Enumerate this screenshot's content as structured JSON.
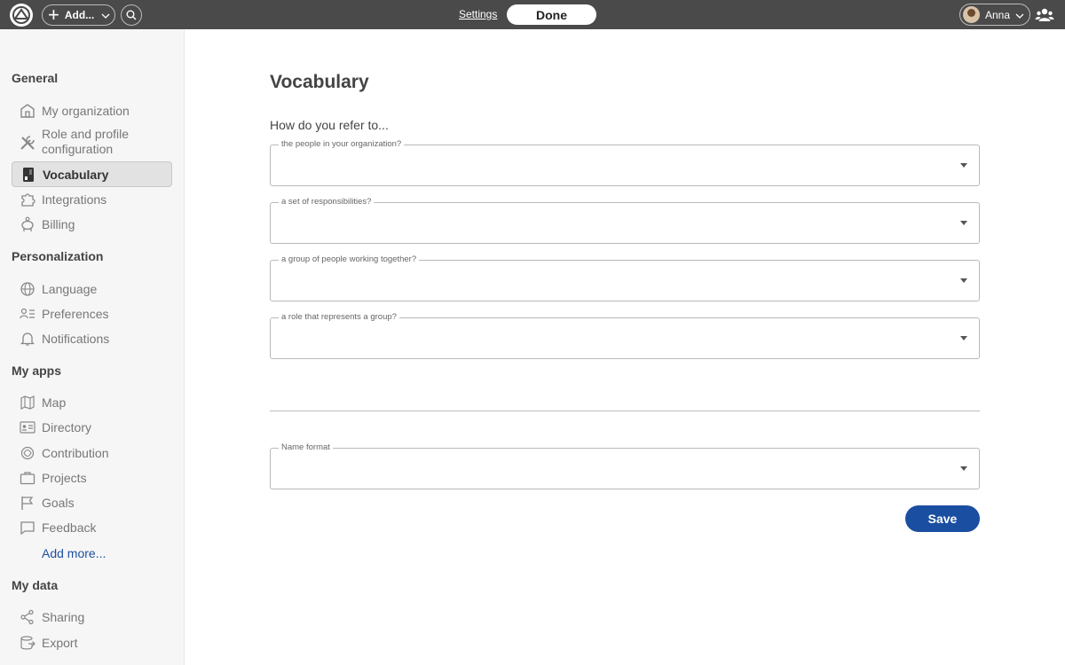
{
  "topbar": {
    "add_label": "Add...",
    "settings_label": "Settings",
    "done_label": "Done",
    "user_name": "Anna"
  },
  "sidebar": {
    "sections": [
      {
        "title": "General",
        "items": [
          {
            "label": "My organization",
            "icon": "building-icon"
          },
          {
            "label": "Role and profile configuration",
            "icon": "tools-icon"
          },
          {
            "label": "Vocabulary",
            "icon": "dictionary-icon",
            "active": true
          },
          {
            "label": "Integrations",
            "icon": "puzzle-icon"
          },
          {
            "label": "Billing",
            "icon": "piggy-bank-icon"
          }
        ]
      },
      {
        "title": "Personalization",
        "items": [
          {
            "label": "Language",
            "icon": "globe-icon"
          },
          {
            "label": "Preferences",
            "icon": "user-list-icon"
          },
          {
            "label": "Notifications",
            "icon": "bell-icon"
          }
        ]
      },
      {
        "title": "My apps",
        "items": [
          {
            "label": "Map",
            "icon": "map-icon"
          },
          {
            "label": "Directory",
            "icon": "id-card-icon"
          },
          {
            "label": "Contribution",
            "icon": "contribution-icon"
          },
          {
            "label": "Projects",
            "icon": "briefcase-icon"
          },
          {
            "label": "Goals",
            "icon": "flag-icon"
          },
          {
            "label": "Feedback",
            "icon": "speech-bubble-icon"
          }
        ],
        "add_more": "Add more..."
      },
      {
        "title": "My data",
        "items": [
          {
            "label": "Sharing",
            "icon": "share-icon"
          },
          {
            "label": "Export",
            "icon": "export-icon"
          }
        ]
      }
    ]
  },
  "main": {
    "title": "Vocabulary",
    "prompt": "How do you refer to...",
    "fields": [
      {
        "label": "the people in your organization?",
        "value": ""
      },
      {
        "label": "a set of responsibilities?",
        "value": ""
      },
      {
        "label": "a group of people working together?",
        "value": ""
      },
      {
        "label": "a role that represents a group?",
        "value": ""
      }
    ],
    "name_format": {
      "label": "Name format",
      "value": ""
    },
    "save_label": "Save"
  },
  "colors": {
    "topbar_bg": "#4a4a4a",
    "sidebar_bg": "#f6f6f6",
    "accent": "#1a4ea0",
    "link": "#1f4fa0"
  }
}
